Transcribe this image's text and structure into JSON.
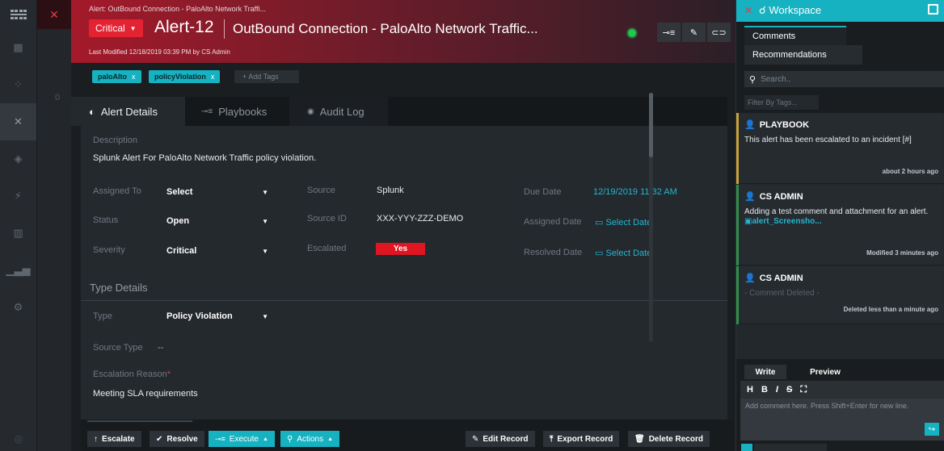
{
  "header": {
    "breadcrumb": "Alert: OutBound Connection - PaloAlto Network Traffi...",
    "severity_label": "Critical",
    "alert_id": "Alert-12",
    "alert_title": "OutBound Connection - PaloAlto Network Traffic...",
    "last_modified": "Last Modified 12/18/2019 03:39 PM by CS Admin"
  },
  "tags": {
    "items": [
      "paloAlto",
      "policyViolation"
    ],
    "add_placeholder": "+ Add Tags"
  },
  "tabs": [
    {
      "label": "Alert Details",
      "icon": "info-icon"
    },
    {
      "label": "Playbooks",
      "icon": "playbook-icon"
    },
    {
      "label": "Audit Log",
      "icon": "eye-icon"
    }
  ],
  "details": {
    "description_label": "Description",
    "description": "Splunk Alert For PaloAlto Network Traffic policy violation.",
    "assigned_to_label": "Assigned To",
    "assigned_to": "Select",
    "status_label": "Status",
    "status": "Open",
    "severity_label": "Severity",
    "severity": "Critical",
    "source_label": "Source",
    "source": "Splunk",
    "source_id_label": "Source ID",
    "source_id": "XXX-YYY-ZZZ-DEMO",
    "escalated_label": "Escalated",
    "escalated": "Yes",
    "due_date_label": "Due Date",
    "due_date": "12/19/2019 11:32 AM",
    "assigned_date_label": "Assigned Date",
    "assigned_date": "Select Date",
    "resolved_date_label": "Resolved Date",
    "resolved_date": "Select Date"
  },
  "type_details": {
    "section_title": "Type Details",
    "type_label": "Type",
    "type": "Policy Violation",
    "source_type_label": "Source Type",
    "source_type": "--",
    "escalation_reason_label": "Escalation Reason",
    "required_mark": "*",
    "escalation_reason": "Meeting SLA requirements"
  },
  "actions": {
    "escalate": "Escalate",
    "resolve": "Resolve",
    "execute": "Execute",
    "actions": "Actions",
    "edit_record": "Edit Record",
    "export_record": "Export Record",
    "delete_record": "Delete Record"
  },
  "workspace": {
    "title": "Workspace",
    "tabs": [
      "Comments",
      "Recommendations"
    ],
    "search_placeholder": "Search..",
    "filter_placeholder": "Filter By Tags...",
    "comments": [
      {
        "author": "PLAYBOOK",
        "text": "This alert has been escalated to an incident [#]",
        "time": "about 2 hours ago"
      },
      {
        "author": "CS ADMIN",
        "text": "Adding a test comment and attachment for an alert.",
        "attachment": "alert_Screensho...",
        "time": "Modified 3 minutes ago"
      },
      {
        "author": "CS ADMIN",
        "text": "- Comment Deleted -",
        "time": "Deleted less than a minute ago"
      }
    ],
    "compose": {
      "tabs": [
        "Write",
        "Preview"
      ],
      "placeholder": "Add comment here. Press Shift+Enter for new line."
    }
  },
  "colors": {
    "accent": "#17b2c1",
    "critical": "#e32232",
    "link": "#22b7d0"
  }
}
